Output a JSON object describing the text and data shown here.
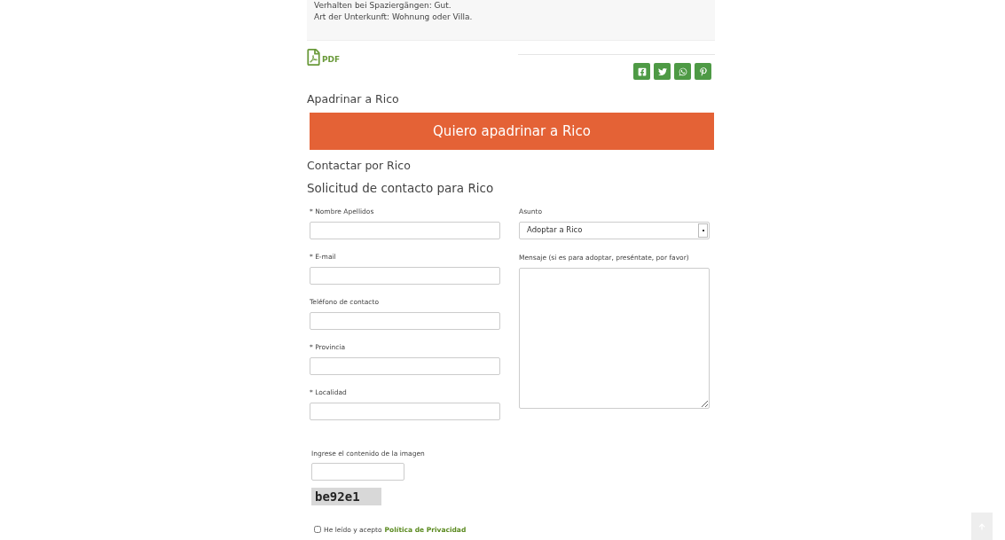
{
  "description": {
    "lines": [
      "Verhalten bei Spaziergängen: Gut.",
      "Art der Unterkunft: Wohnung oder Villa."
    ]
  },
  "pdf_link": "PDF",
  "share_buttons": [
    {
      "kind": "facebook"
    },
    {
      "kind": "twitter"
    },
    {
      "kind": "whatsapp"
    },
    {
      "kind": "pinterest"
    }
  ],
  "sponsor": {
    "heading": "Apadrinar a Rico",
    "button": "Quiero apadrinar a Rico"
  },
  "contact": {
    "heading": "Contactar por Rico",
    "form_title": "Solicitud de contacto para Rico",
    "left_fields": [
      {
        "label": "* Nombre Apellidos"
      },
      {
        "label": "* E-mail"
      },
      {
        "label": "Teléfono de contacto"
      },
      {
        "label": "* Provincia"
      },
      {
        "label": "* Localidad"
      }
    ],
    "subject": {
      "label": "Asunto",
      "value": "Adoptar a Rico"
    },
    "message": {
      "label": "Mensaje (si es para adoptar, preséntate, por favor)"
    },
    "captcha": {
      "label": "Ingrese el contenido de la imagen",
      "code": "be92e1"
    },
    "privacy": {
      "checked": false,
      "text": "He leído y acepto",
      "link": "Política de Privacidad"
    }
  }
}
